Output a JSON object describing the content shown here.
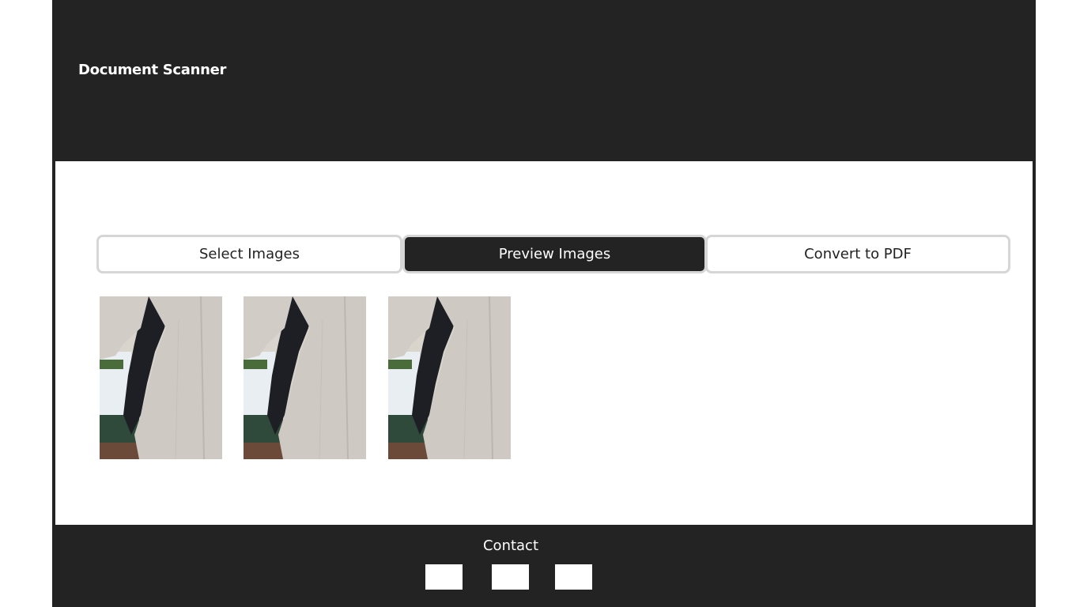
{
  "app": {
    "title": "Document Scanner"
  },
  "tabs": [
    {
      "label": "Select Images",
      "active": false
    },
    {
      "label": "Preview Images",
      "active": true
    },
    {
      "label": "Convert to PDF",
      "active": false
    }
  ],
  "preview": {
    "images": [
      {
        "name": "thumbnail-1"
      },
      {
        "name": "thumbnail-2"
      },
      {
        "name": "thumbnail-3"
      }
    ]
  },
  "footer": {
    "contact_label": "Contact",
    "social_links": [
      "social-link-1",
      "social-link-2",
      "social-link-3"
    ]
  },
  "colors": {
    "dark": "#232323",
    "light": "#ffffff",
    "tab_border": "#d6d6d6"
  }
}
